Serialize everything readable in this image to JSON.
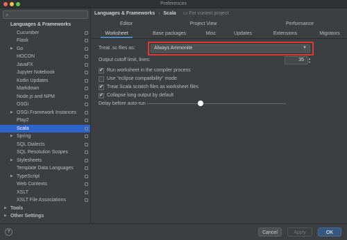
{
  "window": {
    "title": "Preferences"
  },
  "search": {
    "placeholder": ""
  },
  "sidebar": {
    "items": [
      {
        "label": "Languages & Frameworks",
        "kind": "header"
      },
      {
        "label": "Cucumber",
        "kind": "item"
      },
      {
        "label": "Flask",
        "kind": "item"
      },
      {
        "label": "Go",
        "kind": "item",
        "arrow": "▶"
      },
      {
        "label": "HOCON",
        "kind": "item"
      },
      {
        "label": "JavaFX",
        "kind": "item"
      },
      {
        "label": "Jupyter Notebook",
        "kind": "item"
      },
      {
        "label": "Kotlin Updates",
        "kind": "item"
      },
      {
        "label": "Markdown",
        "kind": "item"
      },
      {
        "label": "Node.js and NPM",
        "kind": "item"
      },
      {
        "label": "OSGi",
        "kind": "item"
      },
      {
        "label": "OSGi Framework Instances",
        "kind": "item",
        "arrow": "▶"
      },
      {
        "label": "Play2",
        "kind": "item"
      },
      {
        "label": "Scala",
        "kind": "item",
        "selected": true
      },
      {
        "label": "Spring",
        "kind": "item",
        "arrow": "▶"
      },
      {
        "label": "SQL Dialects",
        "kind": "item"
      },
      {
        "label": "SQL Resolution Scopes",
        "kind": "item"
      },
      {
        "label": "Stylesheets",
        "kind": "item",
        "arrow": "▶"
      },
      {
        "label": "Template Data Languages",
        "kind": "item"
      },
      {
        "label": "TypeScript",
        "kind": "item",
        "arrow": "▶"
      },
      {
        "label": "Web Contexts",
        "kind": "item"
      },
      {
        "label": "XSLT",
        "kind": "item"
      },
      {
        "label": "XSLT File Associations",
        "kind": "item"
      },
      {
        "label": "Tools",
        "kind": "top",
        "arrow": "▶"
      },
      {
        "label": "Other Settings",
        "kind": "top",
        "arrow": "▶"
      }
    ]
  },
  "breadcrumb": {
    "section": "Languages & Frameworks",
    "separator": "›",
    "page": "Scala",
    "note": "For current project"
  },
  "tabs_top": [
    "Editor",
    "Project View",
    "Performance"
  ],
  "tabs_bottom": [
    "Worksheet",
    "Base packages",
    "Misc",
    "Updates",
    "Extensions",
    "Migrators"
  ],
  "settings": {
    "sc_label": "Treat .sc files as:",
    "sc_value": "Always Ammonite",
    "cutoff_label": "Output cutoff limit, lines:",
    "cutoff_value": "35",
    "checks": [
      {
        "label": "Run worksheet in the compiler process",
        "checked": true
      },
      {
        "label": "Use \"eclipse compatibility\" mode",
        "checked": false
      },
      {
        "label": "Treat Scala scratch files as worksheet files",
        "checked": true
      },
      {
        "label": "Collapse long output by default",
        "checked": true
      }
    ],
    "delay_label": "Delay before auto-run"
  },
  "footer": {
    "help": "?",
    "cancel": "Cancel",
    "apply": "Apply",
    "ok": "OK"
  },
  "colors": {
    "accent": "#2f65ca",
    "highlight": "#e03a2e",
    "ok": "#365880"
  }
}
